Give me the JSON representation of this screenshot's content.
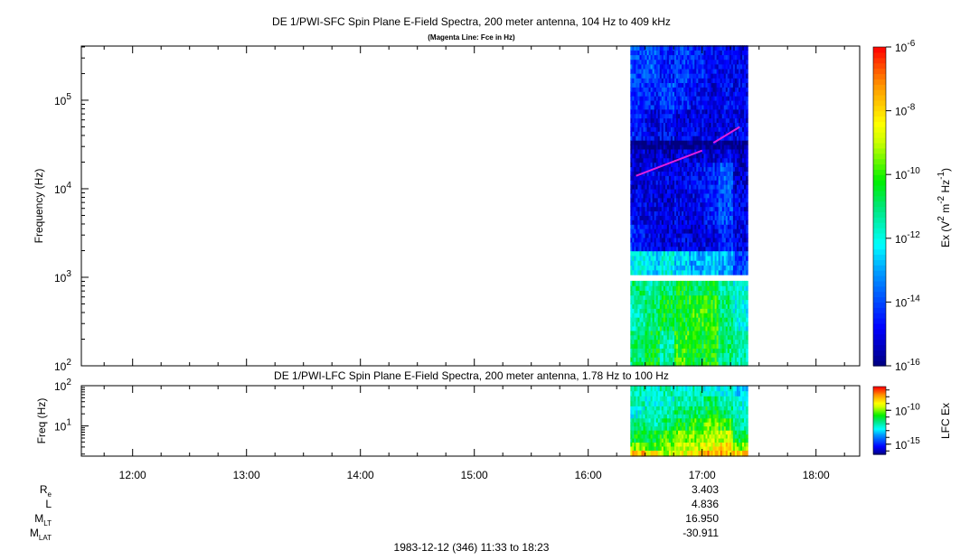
{
  "chart_data": [
    {
      "type": "heatmap",
      "title": "DE 1/PWI-SFC  Spin Plane E-Field Spectra, 200 meter antenna, 104 Hz to 409 kHz",
      "subtitle": "(Magenta Line: Fce in Hz)",
      "ylabel": "Frequency (Hz)",
      "yscale": "log",
      "ylim": [
        100,
        409000
      ],
      "yticks": [
        {
          "v": 2,
          "label": "10",
          "exp": "2"
        },
        {
          "v": 3,
          "label": "10",
          "exp": "3"
        },
        {
          "v": 4,
          "label": "10",
          "exp": "4"
        },
        {
          "v": 5,
          "label": "10",
          "exp": "5"
        }
      ],
      "data_time_range_hours": [
        16.37,
        17.4
      ],
      "gap_log10_freq": [
        2.96,
        3.03
      ],
      "log10_freq_bands": [
        2.0,
        2.4,
        2.8,
        2.96,
        3.03,
        3.3,
        3.6,
        4.0,
        4.3,
        4.45,
        4.55,
        4.9,
        5.2,
        5.62
      ],
      "log10_intensity": [
        [
          -11,
          -10.5,
          -11.5,
          -10,
          -10.5,
          -10.2,
          -11,
          -11.5
        ],
        [
          -11.5,
          -11,
          -10.5,
          -10.5,
          -10,
          -10,
          -11,
          -12
        ],
        [
          -11,
          -11.5,
          -11,
          -10.5,
          -11,
          -10.5,
          -11.5,
          -12
        ],
        [
          null,
          null,
          null,
          null,
          null,
          null,
          null,
          null
        ],
        [
          -12,
          -12.5,
          -12,
          -12.5,
          -13,
          -12.5,
          -13,
          -14
        ],
        [
          -14.5,
          -15,
          -15.2,
          -15,
          -15.2,
          -15,
          -14.5,
          -15
        ],
        [
          -15,
          -15,
          -15.2,
          -15,
          -15,
          -14.5,
          -14,
          -15
        ],
        [
          -15.2,
          -15,
          -15,
          -15,
          -14.8,
          -14.5,
          -13.8,
          -15.2
        ],
        [
          -15.3,
          -15.3,
          -15.3,
          -15.2,
          -15.3,
          -15.2,
          -15,
          -15.3
        ],
        [
          -16,
          -16,
          -16,
          -16,
          -16,
          -16,
          -16,
          -16
        ],
        [
          -14.5,
          -15,
          -14.8,
          -15,
          -15,
          -15.2,
          -15,
          -15
        ],
        [
          -14.3,
          -14.5,
          -14,
          -14.5,
          -14.8,
          -15,
          -14.8,
          -15
        ],
        [
          -14,
          -13.8,
          -14.5,
          -14.2,
          -14.5,
          -14.8,
          -14.8,
          -15
        ]
      ],
      "fce_line": {
        "color": "#e020e0",
        "segments": [
          [
            [
              16.42,
              14000
            ],
            [
              17.0,
              27000
            ]
          ],
          [
            [
              17.1,
              33000
            ],
            [
              17.33,
              50000
            ]
          ]
        ]
      },
      "colorbar": {
        "label": "Ex (V",
        "label_mid": "2",
        "label_m": " m",
        "label_m_exp": "-2",
        "label_hz": " Hz",
        "label_hz_exp": "-1",
        "label_end": ")",
        "range_log10": [
          -16,
          -6
        ],
        "ticks": [
          {
            "v": -6,
            "base": "10",
            "exp": "-6"
          },
          {
            "v": -8,
            "base": "10",
            "exp": "-8"
          },
          {
            "v": -10,
            "base": "10",
            "exp": "-10"
          },
          {
            "v": -12,
            "base": "10",
            "exp": "-12"
          },
          {
            "v": -14,
            "base": "10",
            "exp": "-14"
          },
          {
            "v": -16,
            "base": "10",
            "exp": "-16"
          }
        ]
      }
    },
    {
      "type": "heatmap",
      "title": "DE 1/PWI-LFC  Spin Plane E-Field Spectra, 200 meter antenna, 1.78 Hz to 100 Hz",
      "ylabel": "Freq (Hz)",
      "yscale": "log",
      "ylim": [
        1.78,
        100
      ],
      "yticks": [
        {
          "v": 1,
          "label": "10",
          "exp": "1"
        },
        {
          "v": 2,
          "label": "10",
          "exp": "2"
        }
      ],
      "log10_freq_bands": [
        0.25,
        0.4,
        0.6,
        0.9,
        1.2,
        1.5,
        1.75,
        2.0
      ],
      "log10_intensity": [
        [
          -8,
          -9,
          -9.5,
          -9,
          -8.5,
          -8,
          -8,
          -8.5
        ],
        [
          -10,
          -10.5,
          -10,
          -9.5,
          -9.5,
          -9,
          -8.5,
          -10
        ],
        [
          -11,
          -11,
          -10.5,
          -10,
          -10,
          -9.5,
          -9.5,
          -11
        ],
        [
          -11.5,
          -12,
          -11.5,
          -11,
          -10.5,
          -10,
          -10.5,
          -12
        ],
        [
          -12.5,
          -12,
          -12,
          -11.5,
          -11.5,
          -11,
          -11.5,
          -12.5
        ],
        [
          -12,
          -12.5,
          -12.5,
          -12,
          -12,
          -11.5,
          -12,
          -12.5
        ],
        [
          -12,
          -12.5,
          -12,
          -12.5,
          -12,
          -12.5,
          -12.5,
          -13
        ]
      ],
      "colorbar": {
        "label": "LFC Ex",
        "range_log10": [
          -16.5,
          -6.5
        ],
        "ticks": [
          {
            "v": -10,
            "base": "10",
            "exp": "-10"
          },
          {
            "v": -15,
            "base": "10",
            "exp": "-15"
          }
        ]
      }
    }
  ],
  "time_axis": {
    "range_hours": [
      11.55,
      18.3833
    ],
    "ticks": [
      {
        "v": 12,
        "label": "12:00"
      },
      {
        "v": 13,
        "label": "13:00"
      },
      {
        "v": 14,
        "label": "14:00"
      },
      {
        "v": 15,
        "label": "15:00"
      },
      {
        "v": 16,
        "label": "16:00"
      },
      {
        "v": 17,
        "label": "17:00"
      },
      {
        "v": 18,
        "label": "18:00"
      }
    ]
  },
  "ephemeris": [
    {
      "label": "R",
      "sub": "e",
      "value": "3.403"
    },
    {
      "label": "L",
      "sub": "",
      "value": "4.836"
    },
    {
      "label": "M",
      "sub": "LT",
      "value": "16.950"
    },
    {
      "label": "M",
      "sub": "LAT",
      "value": "-30.911"
    }
  ],
  "footer": "1983-12-12 (346) 11:33 to 18:23"
}
